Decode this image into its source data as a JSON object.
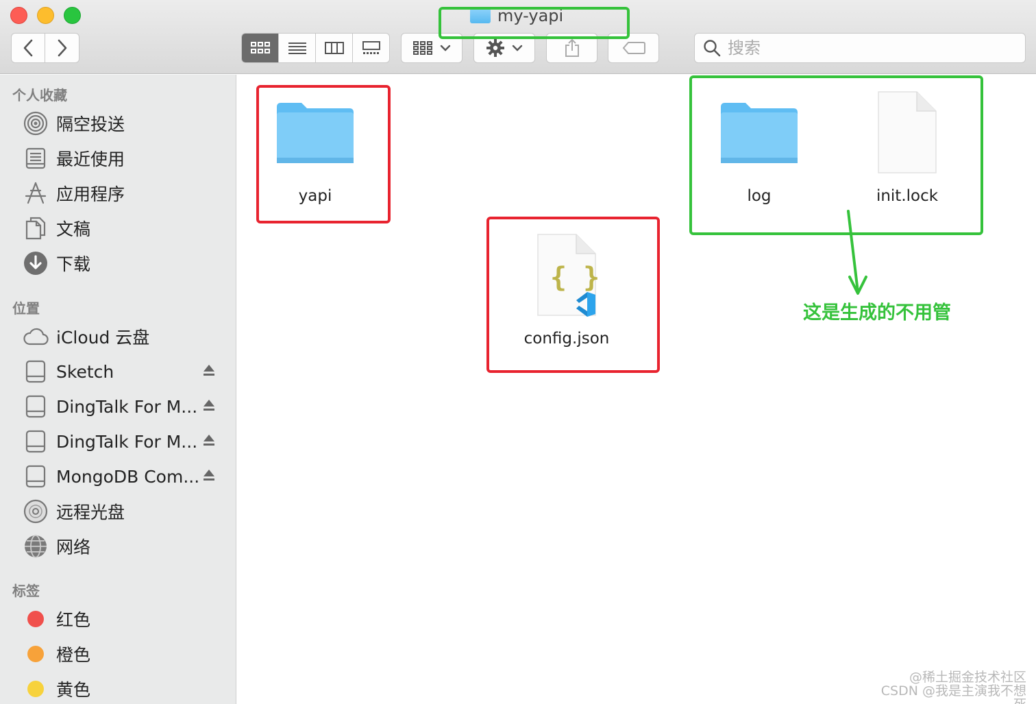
{
  "window": {
    "title": "my-yapi"
  },
  "toolbar": {
    "back_icon": "chevron-left-icon",
    "forward_icon": "chevron-right-icon",
    "view_modes": [
      "icon-view",
      "list-view",
      "column-view",
      "gallery-view"
    ],
    "active_view": "icon-view",
    "search": {
      "placeholder": "搜索",
      "value": ""
    }
  },
  "sidebar": {
    "favorites": {
      "title": "个人收藏",
      "items": [
        {
          "label": "隔空投送",
          "icon": "airdrop-icon"
        },
        {
          "label": "最近使用",
          "icon": "recents-icon"
        },
        {
          "label": "应用程序",
          "icon": "applications-icon"
        },
        {
          "label": "文稿",
          "icon": "documents-icon"
        },
        {
          "label": "下载",
          "icon": "downloads-icon"
        }
      ]
    },
    "locations": {
      "title": "位置",
      "items": [
        {
          "label": "iCloud 云盘",
          "icon": "cloud-icon"
        },
        {
          "label": "Sketch",
          "icon": "disk-icon",
          "eject": true
        },
        {
          "label": "DingTalk For M...",
          "icon": "disk-icon",
          "eject": true
        },
        {
          "label": "DingTalk For M...",
          "icon": "disk-icon",
          "eject": true
        },
        {
          "label": "MongoDB Com...",
          "icon": "disk-icon",
          "eject": true
        },
        {
          "label": "远程光盘",
          "icon": "optical-disc-icon"
        },
        {
          "label": "网络",
          "icon": "network-globe-icon"
        }
      ]
    },
    "tags": {
      "title": "标签",
      "items": [
        {
          "label": "红色",
          "color": "#f0504c"
        },
        {
          "label": "橙色",
          "color": "#f7a23a"
        },
        {
          "label": "黄色",
          "color": "#f7d23c"
        }
      ]
    }
  },
  "files": [
    {
      "name": "yapi",
      "kind": "folder"
    },
    {
      "name": "config.json",
      "kind": "json-file"
    },
    {
      "name": "log",
      "kind": "folder"
    },
    {
      "name": "init.lock",
      "kind": "document"
    }
  ],
  "annotations": {
    "note": "这是生成的不用管",
    "colors": {
      "red": "#e8232f",
      "green": "#35c23b"
    }
  },
  "watermark": {
    "line1": "@稀土掘金技术社区",
    "line2": "CSDN @我是主演我不想死"
  }
}
